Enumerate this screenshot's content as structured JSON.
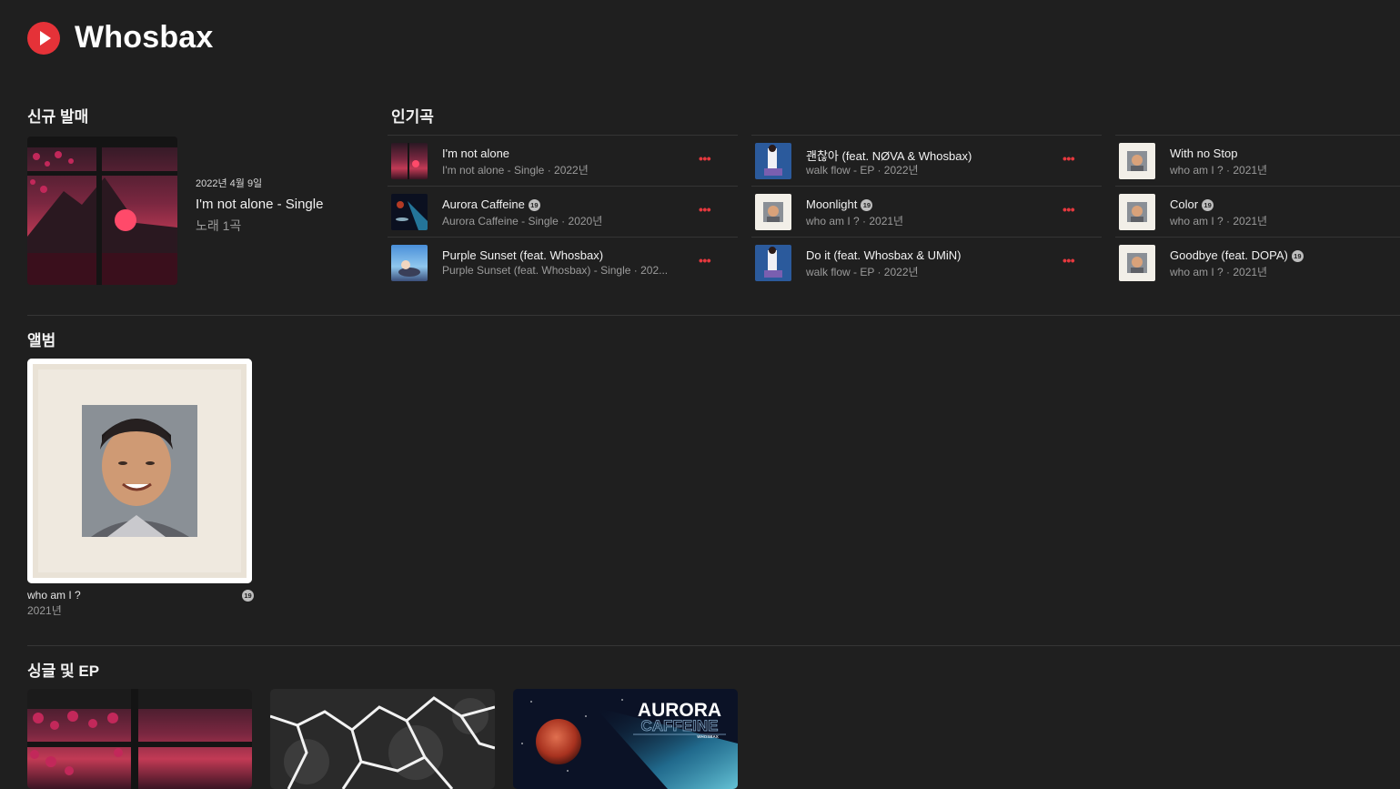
{
  "artist": {
    "name": "Whosbax",
    "logo_icon": "youtube-music-logo"
  },
  "new_release": {
    "section_title": "신규 발매",
    "date": "2022년 4월 9일",
    "title": "I'm not alone - Single",
    "track_count": "노래 1곡"
  },
  "top_songs": {
    "section_title": "인기곡",
    "more_icon": "ellipsis-icon",
    "columns": [
      [
        {
          "title": "I'm not alone",
          "subtitle": "I'm not alone - Single · 2022년",
          "explicit": false
        },
        {
          "title": "Aurora Caffeine",
          "subtitle": "Aurora Caffeine - Single · 2020년",
          "explicit": true
        },
        {
          "title": "Purple Sunset (feat. Whosbax)",
          "subtitle": "Purple Sunset (feat. Whosbax) - Single · 202...",
          "explicit": false
        }
      ],
      [
        {
          "title": "괜찮아 (feat. NØVA & Whosbax)",
          "subtitle": "walk flow - EP · 2022년",
          "explicit": false
        },
        {
          "title": "Moonlight",
          "subtitle": "who am I ? · 2021년",
          "explicit": true
        },
        {
          "title": "Do it (feat. Whosbax & UMiN)",
          "subtitle": "walk flow - EP · 2022년",
          "explicit": false
        }
      ],
      [
        {
          "title": "With no Stop",
          "subtitle": "who am I ? · 2021년",
          "explicit": false
        },
        {
          "title": "Color",
          "subtitle": "who am I ? · 2021년",
          "explicit": true
        },
        {
          "title": "Goodbye (feat. DOPA)",
          "subtitle": "who am I ? · 2021년",
          "explicit": true
        }
      ]
    ]
  },
  "albums": {
    "section_title": "앨범",
    "items": [
      {
        "title": "who am I ?",
        "year": "2021년",
        "explicit": true
      }
    ]
  },
  "singles": {
    "section_title": "싱글 및 EP",
    "items": [
      {
        "art": "red-sunset-window"
      },
      {
        "art": "cracked-black-texture"
      },
      {
        "art": "aurora-caffeine",
        "art_title": "AURORA",
        "art_subtitle": "CAFFEINE",
        "art_artist": "WHOSBAX"
      }
    ]
  },
  "explicit_badge": "19",
  "colors": {
    "background": "#1f1f1f",
    "accent": "#e53238",
    "divider": "#353535"
  }
}
